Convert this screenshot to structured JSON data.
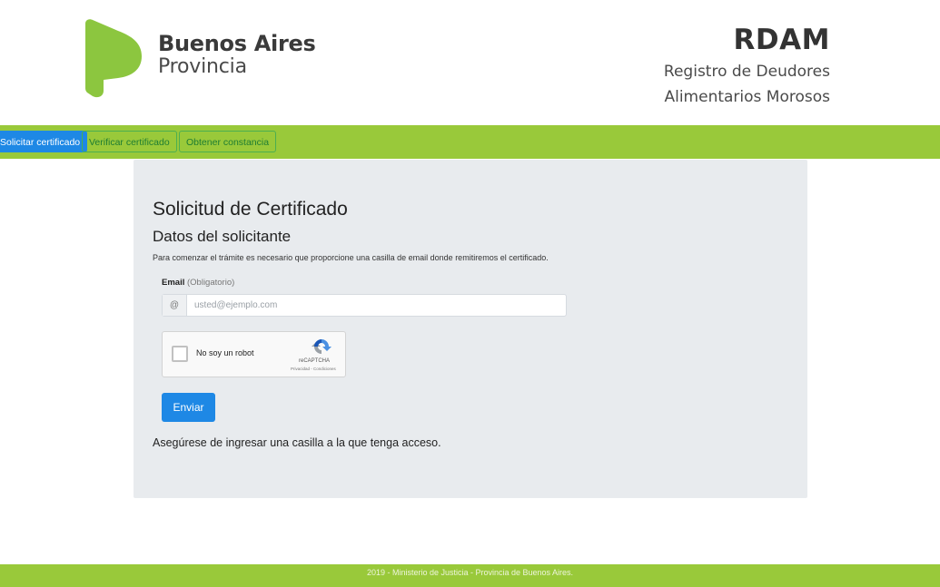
{
  "header": {
    "logo_line1": "Buenos Aires",
    "logo_line2": "Provincia",
    "brand_title": "RDAM",
    "brand_sub1": "Registro de Deudores",
    "brand_sub2": "Alimentarios Morosos"
  },
  "nav": {
    "tabs": [
      {
        "label": "Solicitar certificado",
        "active": true
      },
      {
        "label": "Verificar certificado",
        "active": false
      },
      {
        "label": "Obtener constancia",
        "active": false
      }
    ]
  },
  "form": {
    "title": "Solicitud de Certificado",
    "section": "Datos del solicitante",
    "intro": "Para comenzar el trámite es necesario que proporcione una casilla de email donde remitiremos el certificado.",
    "email_label": "Email",
    "email_hint": "(Obligatorio)",
    "email_addon": "@",
    "email_placeholder": "usted@ejemplo.com",
    "email_value": "",
    "captcha_label": "No soy un robot",
    "captcha_brand": "reCAPTCHA",
    "captcha_links": "Privacidad - Condiciones",
    "submit_label": "Enviar",
    "note": "Asegúrese de ingresar una casilla a la que tenga acceso."
  },
  "footer": {
    "text": "2019 - Ministerio de Justicia - Provincia de Buenos Aires."
  },
  "colors": {
    "accent_green": "#99c93a",
    "primary_blue": "#1e88e5",
    "card_bg": "#e8ebee"
  }
}
